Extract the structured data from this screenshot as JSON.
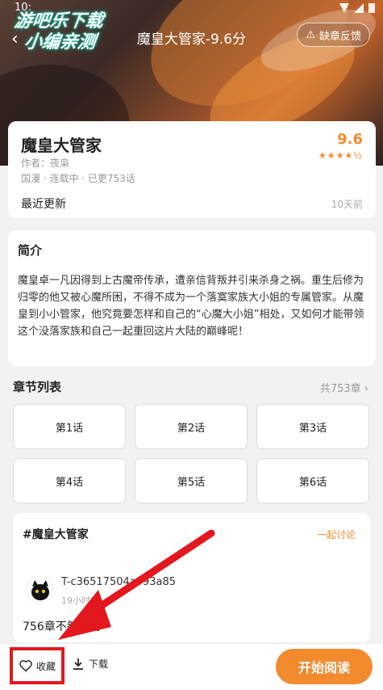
{
  "status_bar": {
    "time": "10:"
  },
  "watermark": {
    "line1": "游吧乐下载",
    "line2": "小编亲测"
  },
  "header": {
    "title": "魔皇大管家-9.6分",
    "feedback_label": "缺章反馈"
  },
  "book": {
    "name": "魔皇大管家",
    "author": "作者：夜枭",
    "meta": "国漫 · 连载中 · 已更753话",
    "score": "9.6",
    "stars": "★★★★½",
    "latest_label": "最近更新",
    "latest_time": "10天前"
  },
  "intro": {
    "heading": "简介",
    "text": "魔皇卓一凡因得到上古魔帝传承，遭亲信背叛并引来杀身之祸。重生后修为归零的他又被心魔所困，不得不成为一个落寞家族大小姐的专属管家。从魔皇到小小管家，他究竟要怎样和自己的“心魔大小姐”相处，又如何才能带领这个没落家族和自己一起重回这片大陆的巅峰呢！"
  },
  "chapters": {
    "heading": "章节列表",
    "total": "共753章 ›",
    "items": [
      "第1话",
      "第2话",
      "第3话",
      "第4话",
      "第5话",
      "第6话"
    ]
  },
  "discussion": {
    "topic": "#魔皇大管家",
    "join_label": "一起讨论",
    "user": "T-c36517504a993a85",
    "time": "19小时前",
    "comment": "756章不新发吗"
  },
  "bottom_bar": {
    "favorite_label": "收藏",
    "download_label": "下载",
    "read_label": "开始阅读"
  },
  "colors": {
    "accent": "#f28a2e",
    "highlight_box": "#e3171e"
  }
}
